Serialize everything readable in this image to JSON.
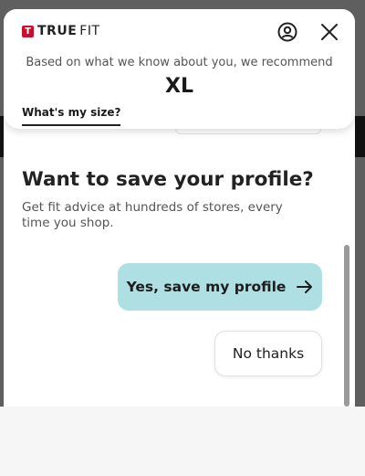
{
  "brand": {
    "mark": "T",
    "name_bold": "TRUE",
    "name_regular": "FIT"
  },
  "header": {
    "recommend_text": "Based on what we know about you, we recommend",
    "size": "XL",
    "tab_label": "What's my size?"
  },
  "save_profile": {
    "title": "Want to save your profile?",
    "description": "Get fit advice at hundreds of stores, every time you shop.",
    "yes_label": "Yes, save my profile",
    "no_label": "No thanks"
  },
  "colors": {
    "brand_red": "#c8102e",
    "primary_button": "#aee0e3",
    "overlay": "#5f5f5f"
  },
  "icons": [
    "account-icon",
    "close-icon",
    "arrow-right-icon"
  ]
}
